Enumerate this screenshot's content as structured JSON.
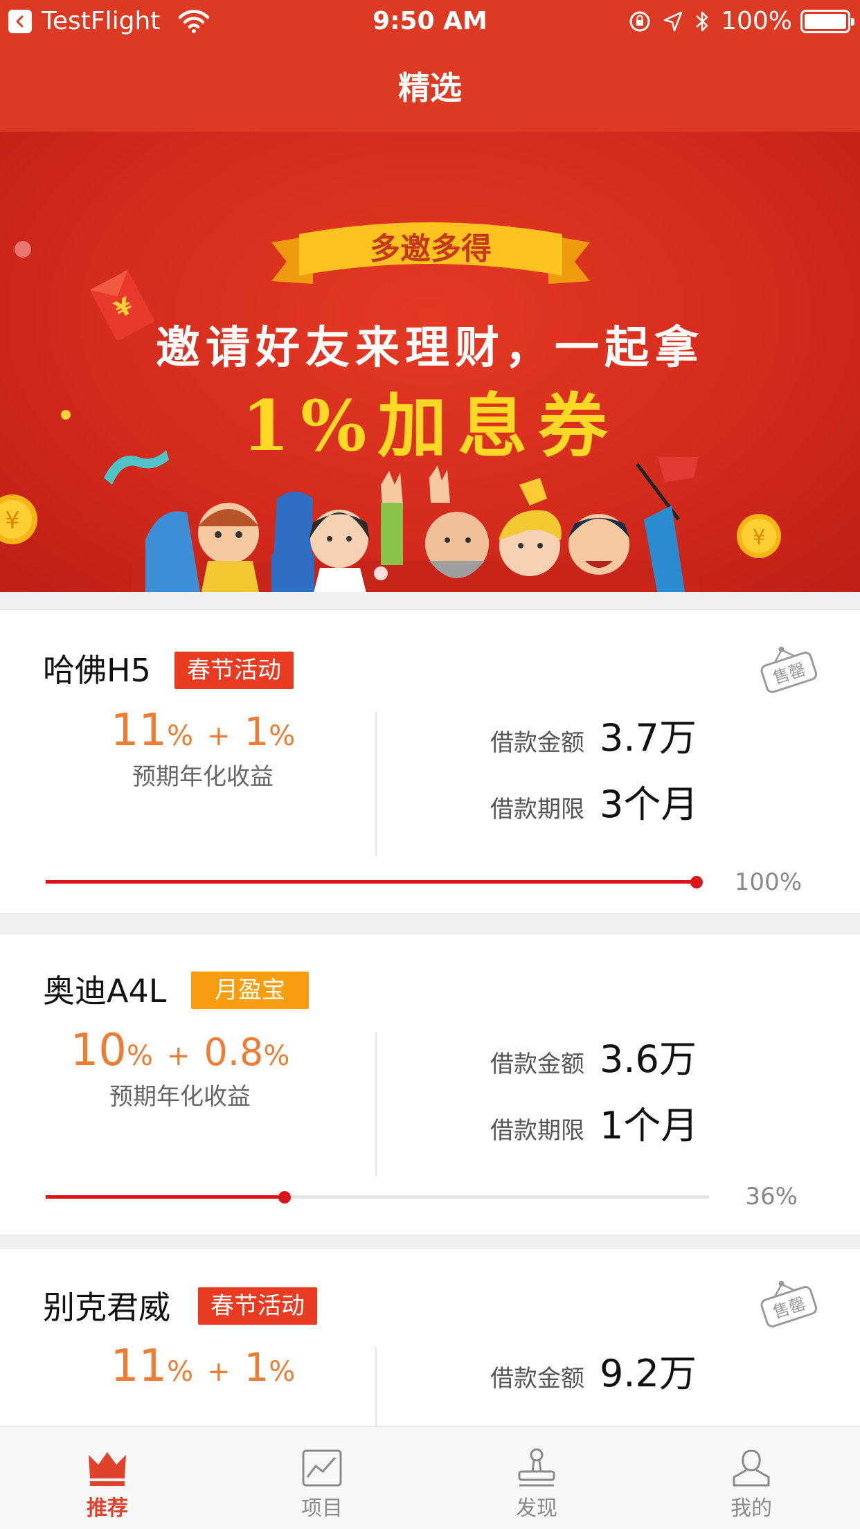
{
  "status_bar": {
    "carrier": "TestFlight",
    "time": "9:50 AM",
    "battery": "100%"
  },
  "nav": {
    "title": "精选"
  },
  "banner": {
    "ribbon": "多邀多得",
    "line1": "邀请好友来理财，一起拿",
    "line2": "1%加息券",
    "coin_symbol": "¥"
  },
  "colors": {
    "header": "#dc3a22",
    "accent_orange": "#ec7d35",
    "progress": "#d9151b",
    "tag_red": "#e93b21",
    "tag_orange": "#f99d10"
  },
  "products": [
    {
      "name": "哈佛H5",
      "tag": "春节活动",
      "sold_out": true,
      "sold_out_label": "售罄",
      "rate_base": "11",
      "rate_bonus": "1",
      "pct": "%",
      "plus": "+",
      "rate_label": "预期年化收益",
      "amount_label": "借款金额",
      "amount": "3.7万",
      "term_label": "借款期限",
      "term": "3个月",
      "progress": 100,
      "progress_text": "100%"
    },
    {
      "name": "奥迪A4L",
      "tag": "月盈宝",
      "sold_out": false,
      "rate_base": "10",
      "rate_bonus": "0.8",
      "pct": "%",
      "plus": "+",
      "rate_label": "预期年化收益",
      "amount_label": "借款金额",
      "amount": "3.6万",
      "term_label": "借款期限",
      "term": "1个月",
      "progress": 36,
      "progress_text": "36%"
    },
    {
      "name": "别克君威",
      "tag": "春节活动",
      "sold_out": true,
      "sold_out_label": "售罄",
      "rate_base": "11",
      "rate_bonus": "1",
      "pct": "%",
      "plus": "+",
      "amount_label": "借款金额",
      "amount": "9.2万"
    }
  ],
  "tabs": [
    {
      "label": "推荐",
      "icon": "crown-icon",
      "active": true
    },
    {
      "label": "项目",
      "icon": "chart-icon",
      "active": false
    },
    {
      "label": "发现",
      "icon": "stamp-icon",
      "active": false
    },
    {
      "label": "我的",
      "icon": "user-icon",
      "active": false
    }
  ]
}
